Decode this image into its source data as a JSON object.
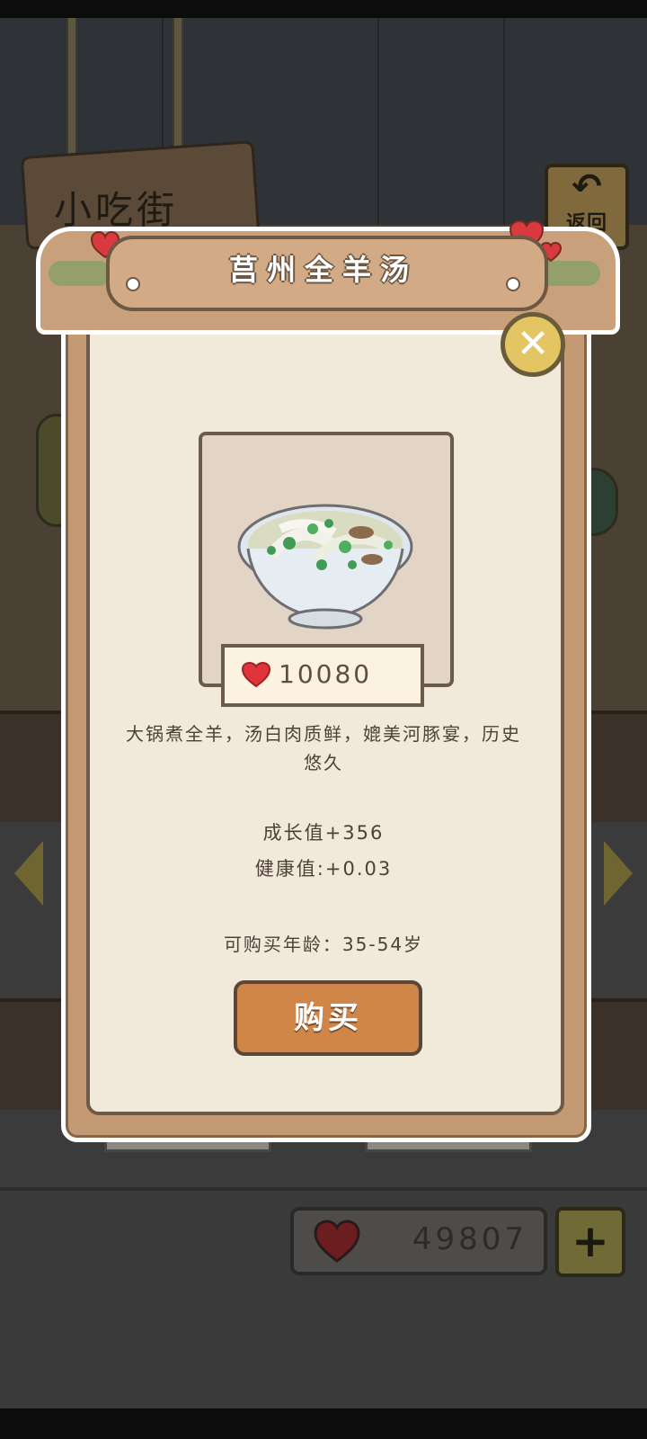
{
  "background": {
    "street_sign": "小吃街",
    "back_button": {
      "icon": "back-arrow-icon",
      "label": "返回"
    },
    "nav_left_icon": "chevron-left-icon",
    "nav_right_icon": "chevron-right-icon",
    "heart_balance": "49807",
    "add_button": "+"
  },
  "modal": {
    "title": "莒州全羊汤",
    "close_icon": "close-icon",
    "food_icon": "lamb-soup-bowl",
    "price": "10080",
    "description": "大锅煮全羊，汤白肉质鲜，媲美河豚宴，历史悠久",
    "growth": "成长值+356",
    "health": "健康值:+0.03",
    "age_range": "可购买年龄：35-54岁",
    "buy_label": "购买"
  },
  "colors": {
    "heart": "#e0343b",
    "board": "#c8a07b",
    "paper": "#f1eadb",
    "buy_button": "#d08648",
    "close_button": "#e3c663"
  }
}
